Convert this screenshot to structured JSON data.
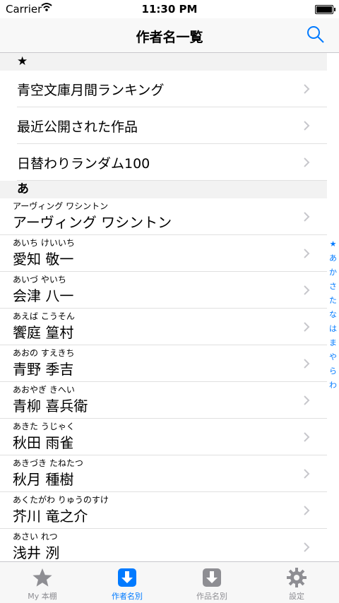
{
  "status": {
    "carrier": "Carrier",
    "time": "11:30 PM"
  },
  "nav": {
    "title": "作者名一覧"
  },
  "sections": {
    "star": "★",
    "a": "あ"
  },
  "menu": [
    "青空文庫月間ランキング",
    "最近公開された作品",
    "日替わりランダム100"
  ],
  "authors": [
    {
      "kana": "アーヴィング ワシントン",
      "name": "アーヴィング ワシントン"
    },
    {
      "kana": "あいち けいいち",
      "name": "愛知 敬一"
    },
    {
      "kana": "あいづ やいち",
      "name": "会津 八一"
    },
    {
      "kana": "あえば こうそん",
      "name": "饗庭 篁村"
    },
    {
      "kana": "あおの すえきち",
      "name": "青野 季吉"
    },
    {
      "kana": "あおやぎ きへい",
      "name": "青柳 喜兵衛"
    },
    {
      "kana": "あきた うじゃく",
      "name": "秋田 雨雀"
    },
    {
      "kana": "あきづき たねたつ",
      "name": "秋月 種樹"
    },
    {
      "kana": "あくたがわ りゅうのすけ",
      "name": "芥川 竜之介"
    },
    {
      "kana": "あさい れつ",
      "name": "浅井 洌"
    }
  ],
  "index": [
    "★",
    "あ",
    "か",
    "さ",
    "た",
    "な",
    "は",
    "ま",
    "や",
    "ら",
    "わ"
  ],
  "tabs": [
    {
      "label": "My 本棚",
      "icon": "star-icon"
    },
    {
      "label": "作者名別",
      "icon": "download-icon"
    },
    {
      "label": "作品名別",
      "icon": "download-icon"
    },
    {
      "label": "設定",
      "icon": "gear-icon"
    }
  ],
  "colors": {
    "accent": "#007aff",
    "inactive": "#8e8e93"
  }
}
